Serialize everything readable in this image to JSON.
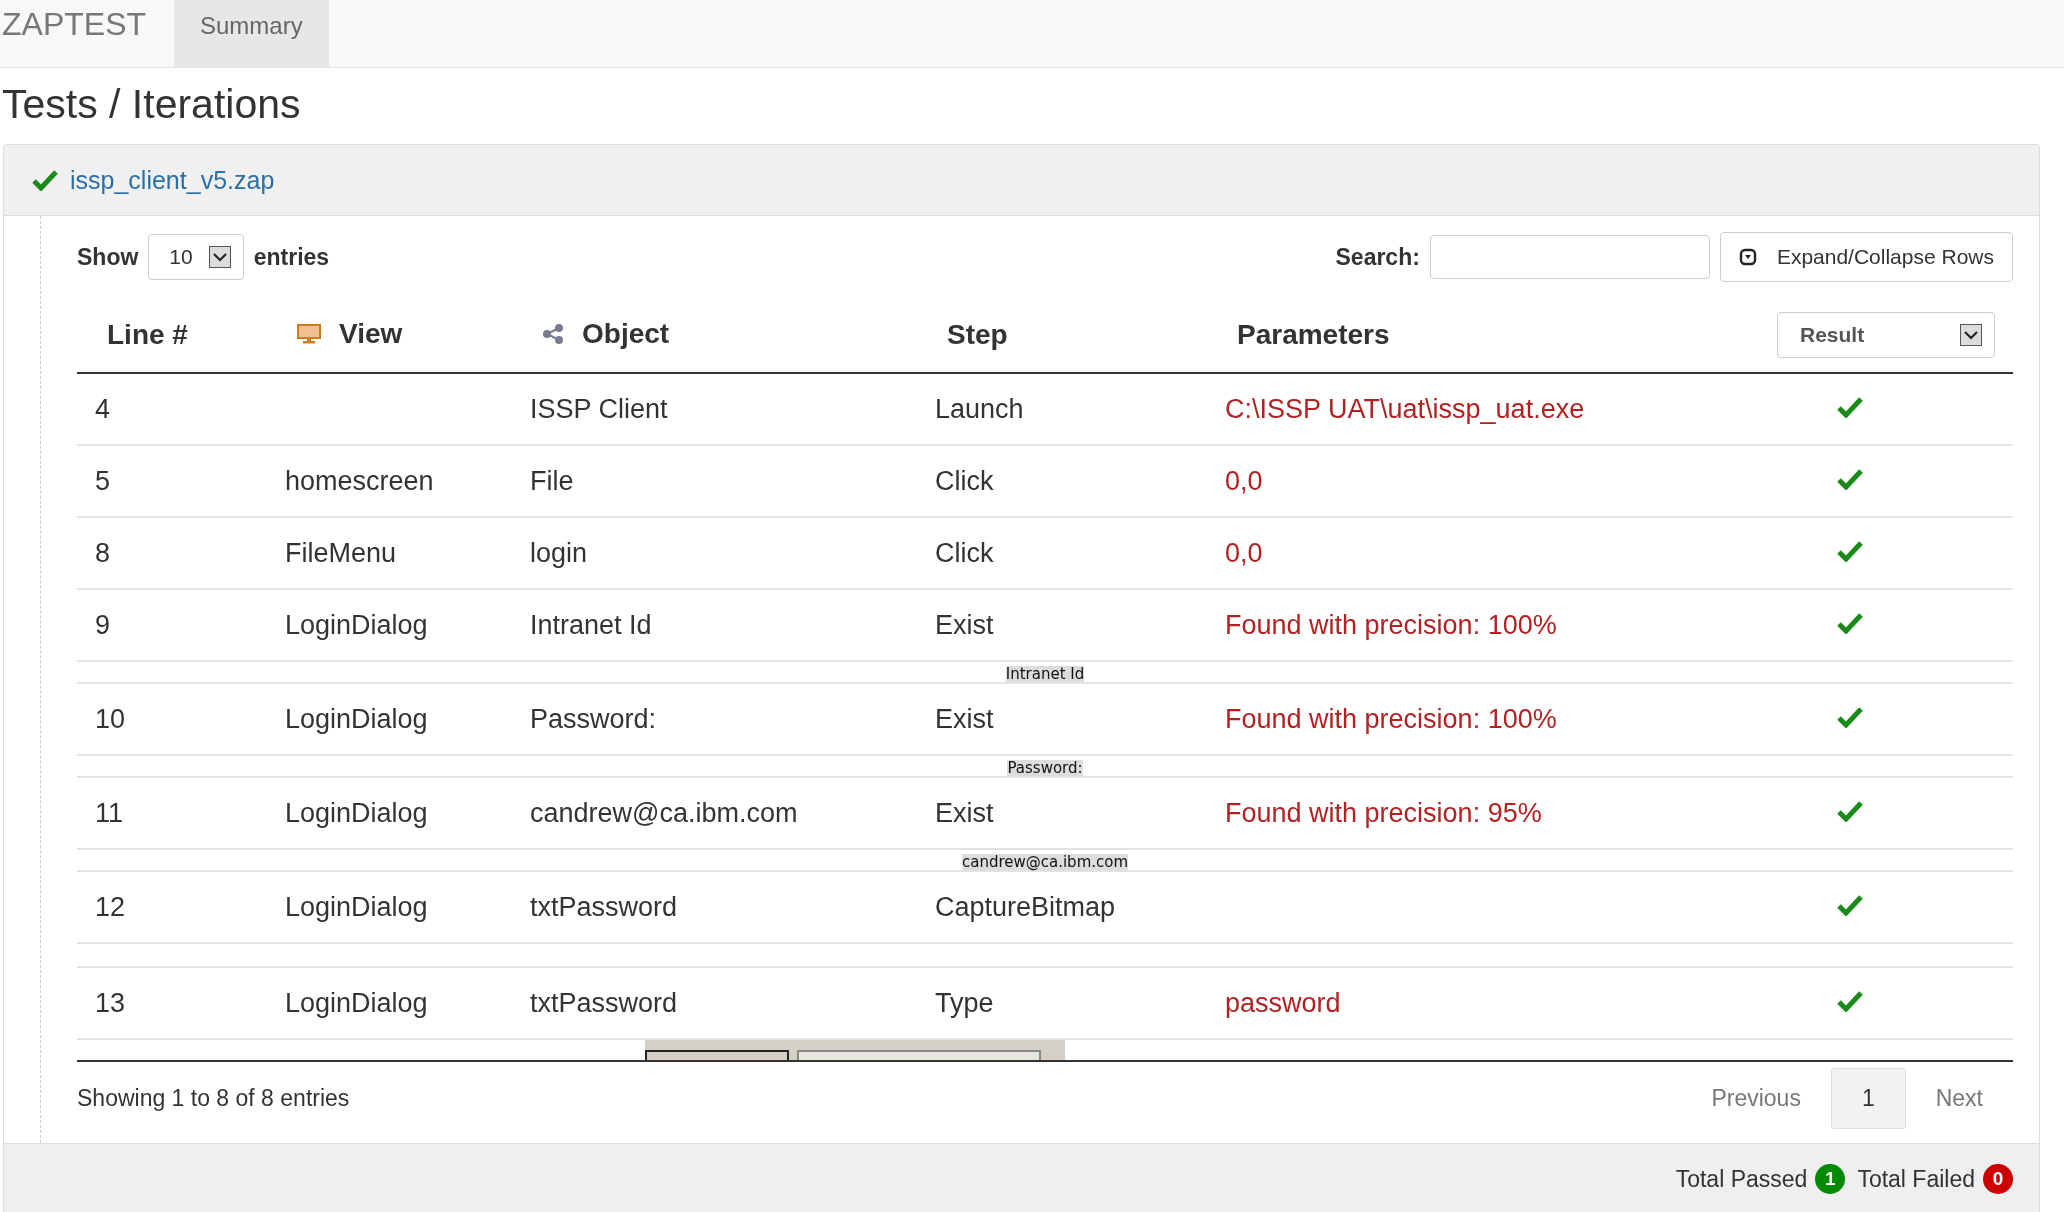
{
  "navbar": {
    "brand": "ZAPTEST",
    "tabs": [
      {
        "label": "Summary",
        "selected": true
      }
    ]
  },
  "page_title": "Tests / Iterations",
  "panel": {
    "passed": true,
    "title": "issp_client_v5.zap"
  },
  "controls": {
    "show_label": "Show",
    "page_size": "10",
    "entries_label": "entries",
    "search_label": "Search:",
    "expand_button": "Expand/Collapse Rows"
  },
  "table": {
    "columns": [
      "Line #",
      "View",
      "Object",
      "Step",
      "Parameters"
    ],
    "result_filter": "Result",
    "rows": [
      {
        "line": "4",
        "object": "ISSP Client",
        "step": "Launch",
        "parameters": "C:\\ISSP UAT\\uat\\issp_uat.exe",
        "passed": true,
        "detail": {
          "kind": "none"
        }
      },
      {
        "line": "5",
        "view": "homescreen",
        "object": "File",
        "step": "Click",
        "parameters": "0,0",
        "passed": true,
        "detail": {
          "kind": "none"
        }
      },
      {
        "line": "8",
        "view": "FileMenu",
        "object": "login",
        "step": "Click",
        "parameters": "0,0",
        "passed": true,
        "detail": {
          "kind": "none"
        }
      },
      {
        "line": "9",
        "view": "LoginDialog",
        "object": "Intranet Id",
        "step": "Exist",
        "parameters": "Found with precision: 100%",
        "passed": true,
        "detail": {
          "kind": "caption",
          "text": "Intranet Id"
        }
      },
      {
        "line": "10",
        "view": "LoginDialog",
        "object": "Password:",
        "step": "Exist",
        "parameters": "Found with precision: 100%",
        "passed": true,
        "detail": {
          "kind": "caption",
          "text": "Password:"
        }
      },
      {
        "line": "11",
        "view": "LoginDialog",
        "object": "candrew@ca.ibm.com",
        "step": "Exist",
        "parameters": "Found with precision: 95%",
        "passed": true,
        "detail": {
          "kind": "caption",
          "text": "candrew@ca.ibm.com"
        }
      },
      {
        "line": "12",
        "view": "LoginDialog",
        "object": "txtPassword",
        "step": "CaptureBitmap",
        "passed": true,
        "detail": {
          "kind": "blank"
        }
      },
      {
        "line": "13",
        "view": "LoginDialog",
        "object": "txtPassword",
        "step": "Type",
        "parameters": "password",
        "passed": true,
        "detail": {
          "kind": "bitmap"
        }
      }
    ]
  },
  "footer": {
    "info": "Showing 1 to 8 of 8 entries",
    "pages": [
      {
        "label": "Previous",
        "selected": false
      },
      {
        "label": "1",
        "selected": true
      },
      {
        "label": "Next",
        "selected": false
      }
    ]
  },
  "totals": [
    {
      "label": "Total Passed",
      "count": "1",
      "color": "#008a00"
    },
    {
      "label": "Total Failed",
      "count": "0",
      "color": "#cc0000"
    }
  ]
}
